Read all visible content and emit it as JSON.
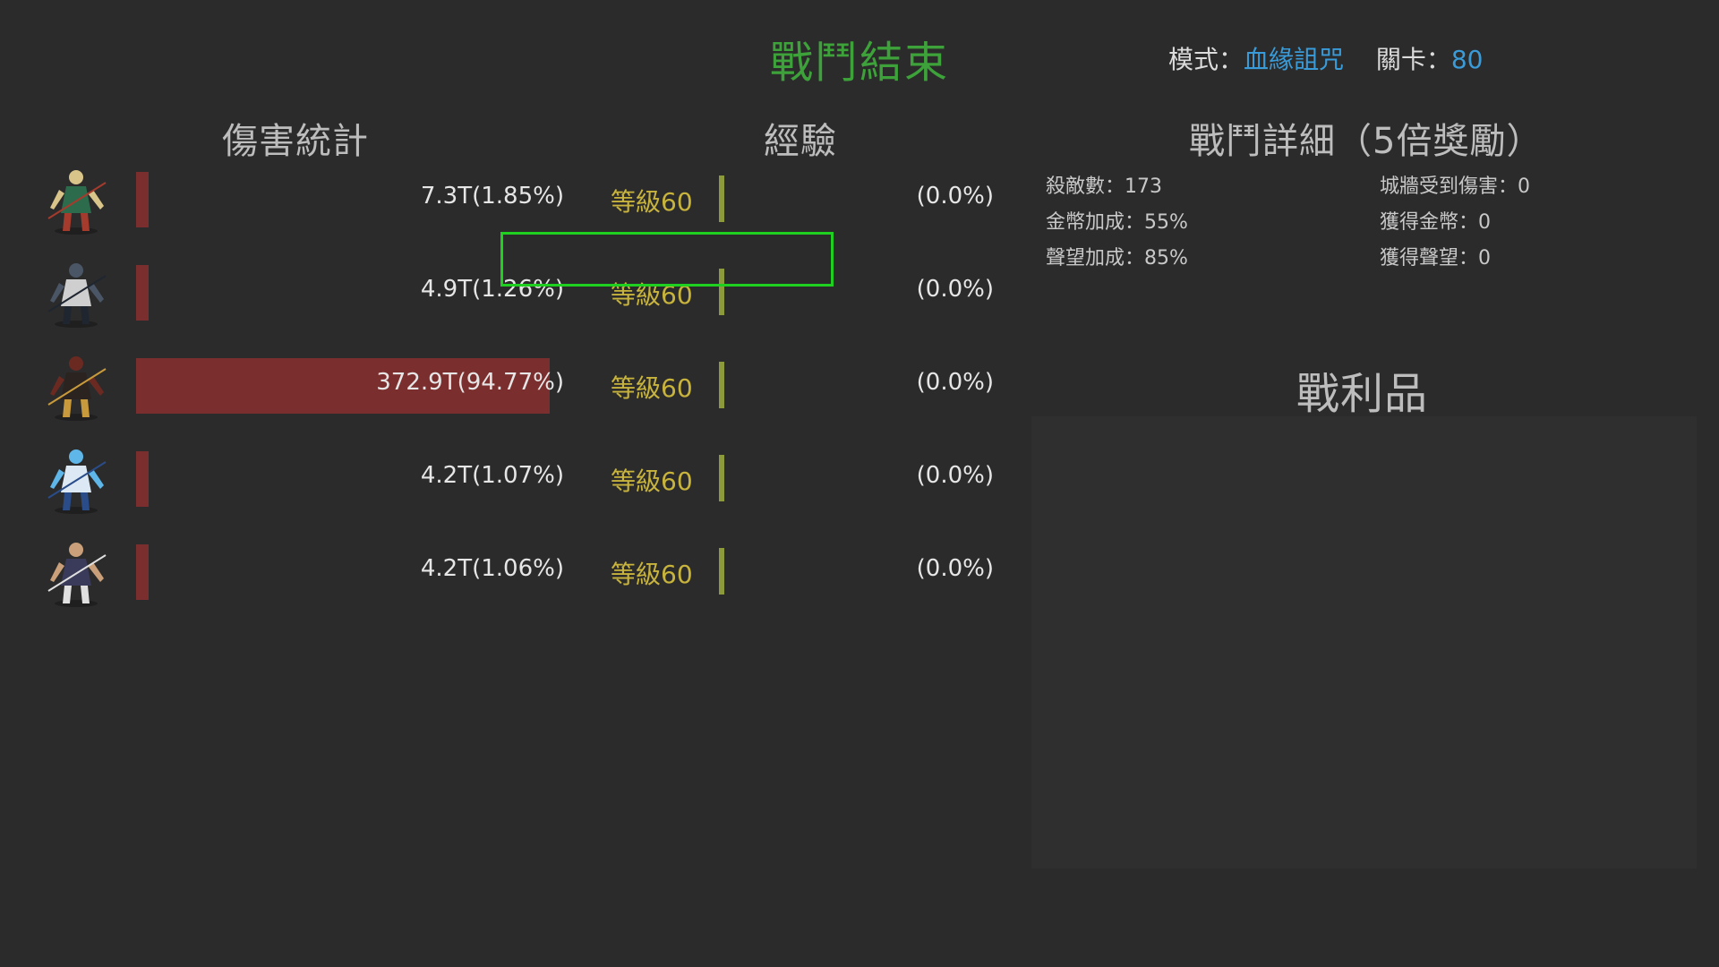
{
  "header": {
    "title": "戰鬥結束",
    "mode_label": "模式：",
    "mode_value": "血緣詛咒",
    "stage_label": "關卡：",
    "stage_value": "80"
  },
  "sections": {
    "damage": "傷害統計",
    "exp": "經驗",
    "detail": "戰鬥詳細（5倍獎勵）",
    "loot": "戰利品"
  },
  "heroes": [
    {
      "portrait": "archer-elf-icon",
      "damage": "7.3T(1.85%)",
      "damage_share": 1.85,
      "level": "等級60",
      "exp_pct": "(0.0%)",
      "exp_value": 0.0,
      "colors": [
        "#d9c58a",
        "#2d6b4d",
        "#a43b2c"
      ]
    },
    {
      "portrait": "swordsman-icon",
      "damage": "4.9T(1.26%)",
      "damage_share": 1.26,
      "level": "等級60",
      "exp_pct": "(0.0%)",
      "exp_value": 0.0,
      "colors": [
        "#4a5566",
        "#cfcfcf",
        "#1f2630"
      ]
    },
    {
      "portrait": "dark-hunter-icon",
      "damage": "372.9T(94.77%)",
      "damage_share": 94.77,
      "level": "等級60",
      "exp_pct": "(0.0%)",
      "exp_value": 0.0,
      "colors": [
        "#6a2a22",
        "#2b2320",
        "#c89a3c"
      ]
    },
    {
      "portrait": "ice-mage-icon",
      "damage": "4.2T(1.07%)",
      "damage_share": 1.07,
      "level": "等級60",
      "exp_pct": "(0.0%)",
      "exp_value": 0.0,
      "colors": [
        "#5fb6e8",
        "#dce9f5",
        "#2a4d8a"
      ]
    },
    {
      "portrait": "blade-dancer-icon",
      "damage": "4.2T(1.06%)",
      "damage_share": 1.06,
      "level": "等級60",
      "exp_pct": "(0.0%)",
      "exp_value": 0.0,
      "colors": [
        "#c9a07a",
        "#3a3a5a",
        "#e0e0e0"
      ]
    }
  ],
  "detail": {
    "kills": "殺敵數：173",
    "gold_bonus": "金幣加成：55%",
    "fame_bonus": "聲望加成：85%",
    "wall_damage": "城牆受到傷害：0",
    "gold_gained": "獲得金幣：0",
    "fame_gained": "獲得聲望：0"
  },
  "colors": {
    "title": "#3da23a",
    "highlight": "#3a9bd9",
    "damage_bar": "#7b2e2e",
    "level_text": "#c8b43c",
    "exp_bar": "#8d9a3b",
    "selection": "#1fd020"
  }
}
